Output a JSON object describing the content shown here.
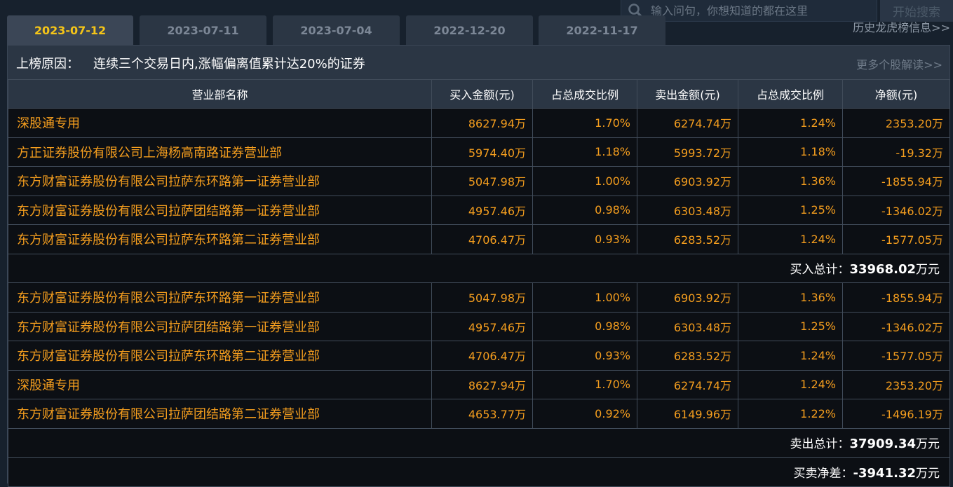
{
  "search": {
    "placeholder": "输入问句，你想知道的都在这里",
    "button_label": "开始搜索"
  },
  "tabs": [
    {
      "label": "2023-07-12",
      "active": true
    },
    {
      "label": "2023-07-11",
      "active": false
    },
    {
      "label": "2023-07-04",
      "active": false
    },
    {
      "label": "2022-12-20",
      "active": false
    },
    {
      "label": "2022-11-17",
      "active": false
    }
  ],
  "history_link": "历史龙虎榜信息>>",
  "reason": {
    "label": "上榜原因：",
    "text": "连续三个交易日内,涨幅偏离值累计达20%的证券",
    "more_link": "更多个股解读>>"
  },
  "table": {
    "headers": [
      "营业部名称",
      "买入金额(元)",
      "占总成交比例",
      "卖出金额(元)",
      "占总成交比例",
      "净额(元)"
    ],
    "buy_rows": [
      [
        "深股通专用",
        "8627.94万",
        "1.70%",
        "6274.74万",
        "1.24%",
        "2353.20万"
      ],
      [
        "方正证券股份有限公司上海杨高南路证券营业部",
        "5974.40万",
        "1.18%",
        "5993.72万",
        "1.18%",
        "-19.32万"
      ],
      [
        "东方财富证券股份有限公司拉萨东环路第一证券营业部",
        "5047.98万",
        "1.00%",
        "6903.92万",
        "1.36%",
        "-1855.94万"
      ],
      [
        "东方财富证券股份有限公司拉萨团结路第一证券营业部",
        "4957.46万",
        "0.98%",
        "6303.48万",
        "1.25%",
        "-1346.02万"
      ],
      [
        "东方财富证券股份有限公司拉萨东环路第二证券营业部",
        "4706.47万",
        "0.93%",
        "6283.52万",
        "1.24%",
        "-1577.05万"
      ]
    ],
    "buy_total": {
      "label": "买入总计：",
      "value": "33968.02",
      "unit": "万元"
    },
    "sell_rows": [
      [
        "东方财富证券股份有限公司拉萨东环路第一证券营业部",
        "5047.98万",
        "1.00%",
        "6903.92万",
        "1.36%",
        "-1855.94万"
      ],
      [
        "东方财富证券股份有限公司拉萨团结路第一证券营业部",
        "4957.46万",
        "0.98%",
        "6303.48万",
        "1.25%",
        "-1346.02万"
      ],
      [
        "东方财富证券股份有限公司拉萨东环路第二证券营业部",
        "4706.47万",
        "0.93%",
        "6283.52万",
        "1.24%",
        "-1577.05万"
      ],
      [
        "深股通专用",
        "8627.94万",
        "1.70%",
        "6274.74万",
        "1.24%",
        "2353.20万"
      ],
      [
        "东方财富证券股份有限公司拉萨团结路第二证券营业部",
        "4653.77万",
        "0.92%",
        "6149.96万",
        "1.22%",
        "-1496.19万"
      ]
    ],
    "sell_total": {
      "label": "卖出总计：",
      "value": "37909.34",
      "unit": "万元"
    },
    "net_total": {
      "label": "买卖净差：",
      "value": "-3941.32",
      "unit": "万元"
    }
  },
  "colors": {
    "accent_tab": "#f5c518",
    "value_orange": "#f59e1e",
    "background": "#17212d",
    "panel": "#0c0f14"
  }
}
